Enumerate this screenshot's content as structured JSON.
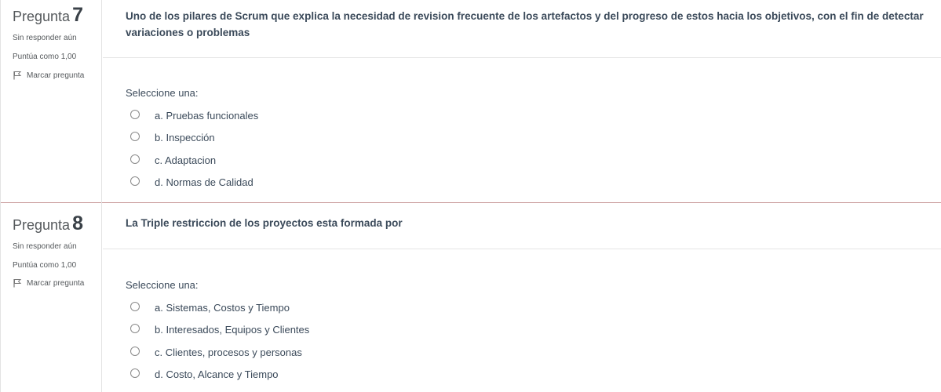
{
  "questions": [
    {
      "label": "Pregunta",
      "number": "7",
      "state": "Sin responder aún",
      "grade": "Puntúa como 1,00",
      "flag_label": "Marcar pregunta",
      "text": "Uno de los pilares de Scrum que explica la necesidad de revision frecuente de los artefactos y del progreso de estos hacia los objetivos, con el fin de detectar variaciones o problemas",
      "prompt": "Seleccione una:",
      "options": [
        "a. Pruebas funcionales",
        "b. Inspección",
        "c. Adaptacion",
        "d. Normas de Calidad"
      ]
    },
    {
      "label": "Pregunta",
      "number": "8",
      "state": "Sin responder aún",
      "grade": "Puntúa como 1,00",
      "flag_label": "Marcar pregunta",
      "text": "La Triple restriccion de los proyectos esta formada por",
      "prompt": "Seleccione una:",
      "options": [
        "a. Sistemas, Costos y Tiempo",
        "b. Interesados, Equipos y Clientes",
        "c. Clientes, procesos y personas",
        "d. Costo, Alcance y Tiempo"
      ]
    }
  ],
  "icons": {
    "flag": "flag-icon",
    "radio": "radio-button-icon"
  },
  "colors": {
    "separator": "#c89a9a",
    "question_text": "#3b4a5a"
  }
}
